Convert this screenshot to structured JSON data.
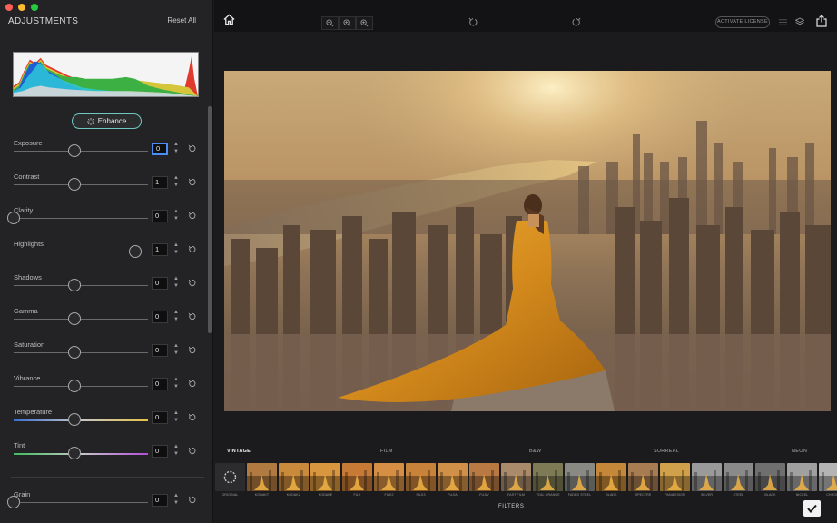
{
  "sidebar": {
    "title": "ADJUSTMENTS",
    "reset_all": "Reset All",
    "enhance_label": "Enhance",
    "sliders": [
      {
        "label": "Exposure",
        "value": "0",
        "level": 0.5
      },
      {
        "label": "Contrast",
        "value": "1",
        "level": 0.5
      },
      {
        "label": "Clarity",
        "value": "0",
        "level": 0.0
      },
      {
        "label": "Highlights",
        "value": "1",
        "level": 1.0
      },
      {
        "label": "Shadows",
        "value": "0",
        "level": 0.5
      },
      {
        "label": "Gamma",
        "value": "0",
        "level": 0.5
      },
      {
        "label": "Saturation",
        "value": "0",
        "level": 0.5
      },
      {
        "label": "Vibrance",
        "value": "0",
        "level": 0.5
      },
      {
        "label": "Temperature",
        "value": "0",
        "level": 0.5
      },
      {
        "label": "Tint",
        "value": "0",
        "level": 0.5
      },
      {
        "label": "Grain",
        "value": "0",
        "level": 0.0
      }
    ]
  },
  "toolbar": {
    "activate_label": "ACTIVATE LICENSE"
  },
  "filters": {
    "categories": [
      "VINTAGE",
      "FILM",
      "B&W",
      "SURREAL",
      "NEON"
    ],
    "active_category": "VINTAGE",
    "title": "FILTERS",
    "items": [
      "ORIGINAL",
      "KODAKT",
      "KODAKZ",
      "KODAKE",
      "FUJI",
      "FUJI2",
      "FUJI3",
      "FUJIA",
      "FUJIV",
      "FAST FILM",
      "TEAL ORANGE",
      "FADED STEEL",
      "BLADE",
      "SPECTRE",
      "PANAVISION",
      "SILVER",
      "STEEL",
      "BLACK",
      "NICKEL",
      "CHROME"
    ]
  },
  "colors": {
    "accent": "#4b8df8",
    "enhance_border": "#6fc6c2",
    "background": "#1b1b1d"
  }
}
